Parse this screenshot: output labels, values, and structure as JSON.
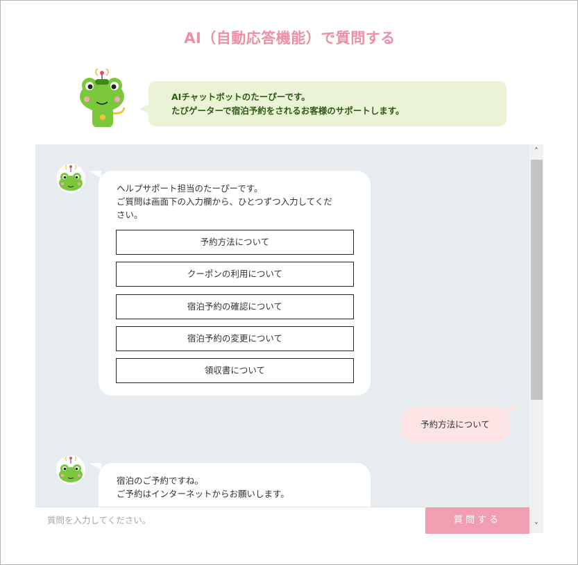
{
  "header": {
    "title": "AI（自動応答機能）で質問する"
  },
  "intro": {
    "line1": "AIチャットボットのたーぴーです。",
    "line2": "たびゲーターで宿泊予約をされるお客様のサポートします。"
  },
  "messages": [
    {
      "sender": "bot",
      "lines": [
        "ヘルプサポート担当のたーぴーです。",
        "ご質問は画面下の入力欄から、ひとつずつ入力してくだ",
        "さい。"
      ],
      "options": [
        "予約方法について",
        "クーポンの利用について",
        "宿泊予約の確認について",
        "宿泊予約の変更について",
        "領収書について"
      ]
    },
    {
      "sender": "user",
      "text": "予約方法について"
    },
    {
      "sender": "bot",
      "lines": [
        "宿泊のご予約ですね。",
        "ご予約はインターネットからお願いします。"
      ]
    }
  ],
  "input": {
    "placeholder": "質問を入力してください。",
    "value": ""
  },
  "send_button": {
    "label": "質問する"
  },
  "colors": {
    "accent_pink": "#ec8fa7",
    "intro_bg": "#eaf3d6",
    "intro_text": "#2e5a14",
    "chat_bg": "#e7ecf0",
    "user_bubble": "#fde5e5",
    "send_button": "#f29eb2"
  },
  "icons": {
    "mascot": "frog-mascot-icon",
    "scroll_up": "chevron-up-icon",
    "scroll_down": "chevron-down-icon"
  }
}
